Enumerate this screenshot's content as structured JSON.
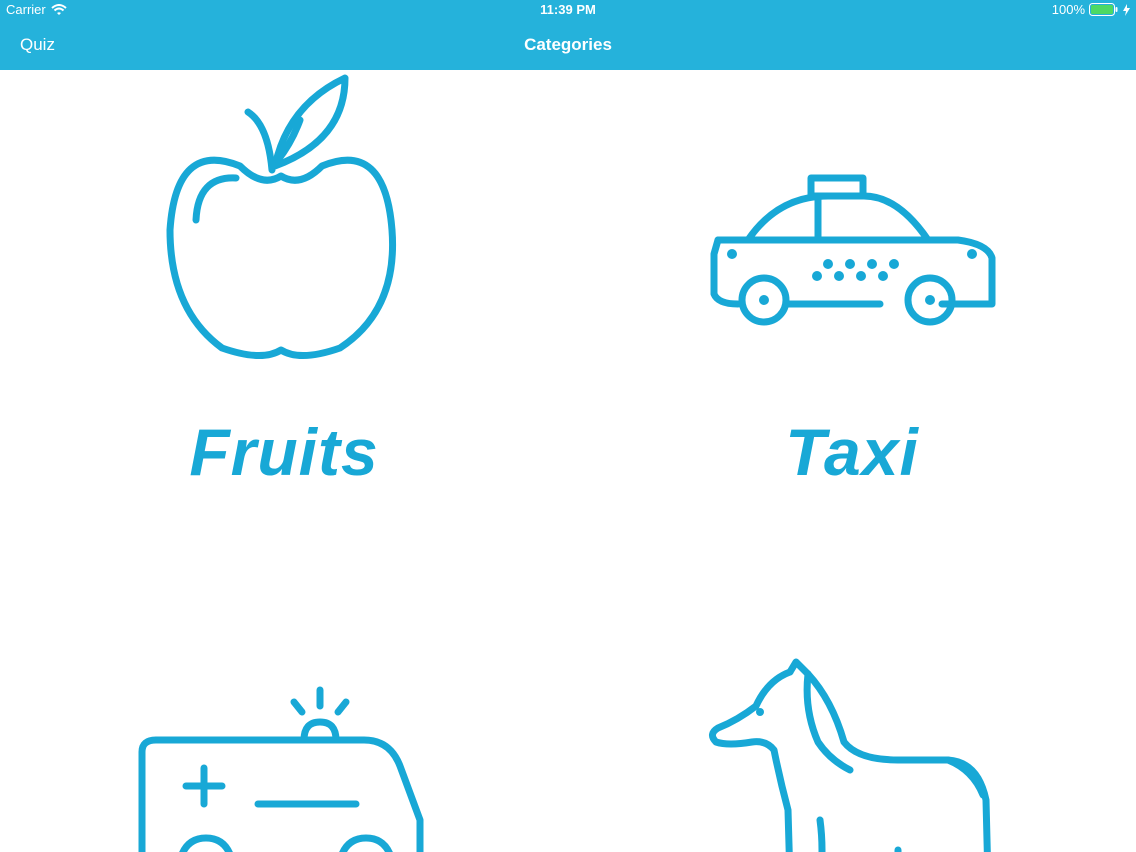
{
  "status_bar": {
    "carrier": "Carrier",
    "time": "11:39 PM",
    "battery": "100%"
  },
  "nav": {
    "back_label": "Quiz",
    "title": "Categories"
  },
  "categories": [
    {
      "label": "Fruits",
      "icon": "apple-icon"
    },
    {
      "label": "Taxi",
      "icon": "taxi-icon"
    },
    {
      "label": "",
      "icon": "ambulance-icon"
    },
    {
      "label": "",
      "icon": "horse-icon"
    }
  ],
  "colors": {
    "bar": "#25b2db",
    "accent": "#18a8d6",
    "battery": "#4cd964"
  }
}
